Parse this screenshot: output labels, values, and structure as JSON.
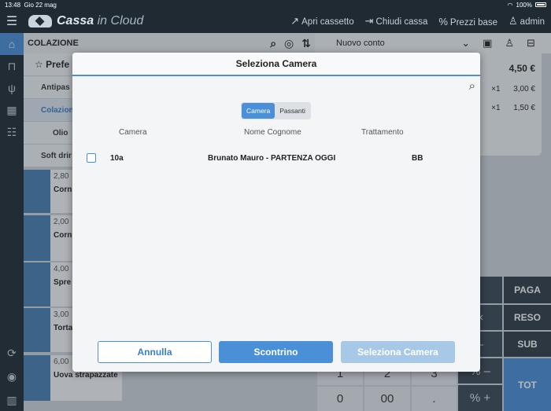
{
  "status": {
    "time": "13:48",
    "date": "Gio 22 mag",
    "battery": "100%"
  },
  "app": {
    "brand_main": "Cassa",
    "brand_light": "in Cloud",
    "actions": {
      "apri_cassetto": "Apri cassetto",
      "chiudi_cassa": "Chiudi cassa",
      "prezzi_base": "Prezzi base",
      "admin": "admin"
    }
  },
  "background": {
    "category": "COLAZIONE",
    "preferiti": "Prefe",
    "rows": [
      "Antipas",
      "Colazion",
      "Olio",
      "Soft drir"
    ],
    "tiles": [
      {
        "price": "2,80",
        "name": "Corn"
      },
      {
        "price": "2,00",
        "name": "Corn migr pista"
      },
      {
        "price": "4,00",
        "name": "Spre aran"
      },
      {
        "price": "3,00",
        "name": "Torta"
      },
      {
        "price": "6,00",
        "name": "Uova strapazzate"
      }
    ],
    "conto": "Nuovo conto",
    "total": "4,50 €",
    "lines": [
      {
        "qty": "×1",
        "price": "3,00 €"
      },
      {
        "qty": "×1",
        "price": "1,50 €"
      }
    ],
    "keypad": {
      "paga": "PAGA",
      "reso": "RESO",
      "sub": "SUB",
      "tot": "TOT",
      "k1": "1",
      "k2": "2",
      "k3": "3",
      "k0": "0",
      "k00": "00",
      "dot": ".",
      "pct_minus": "% –",
      "pct_plus": "% +",
      "times": "×",
      "minus": "–"
    }
  },
  "modal": {
    "title": "Seleziona Camera",
    "tabs": [
      "Camera",
      "Passanti"
    ],
    "columns": {
      "camera": "Camera",
      "nome": "Nome Cognome",
      "trattamento": "Trattamento"
    },
    "rows": [
      {
        "camera": "10a",
        "nome": "Brunato Mauro - PARTENZA OGGI",
        "trattamento": "BB"
      }
    ],
    "buttons": {
      "annulla": "Annulla",
      "scontrino": "Scontrino",
      "seleziona": "Seleziona Camera"
    }
  }
}
